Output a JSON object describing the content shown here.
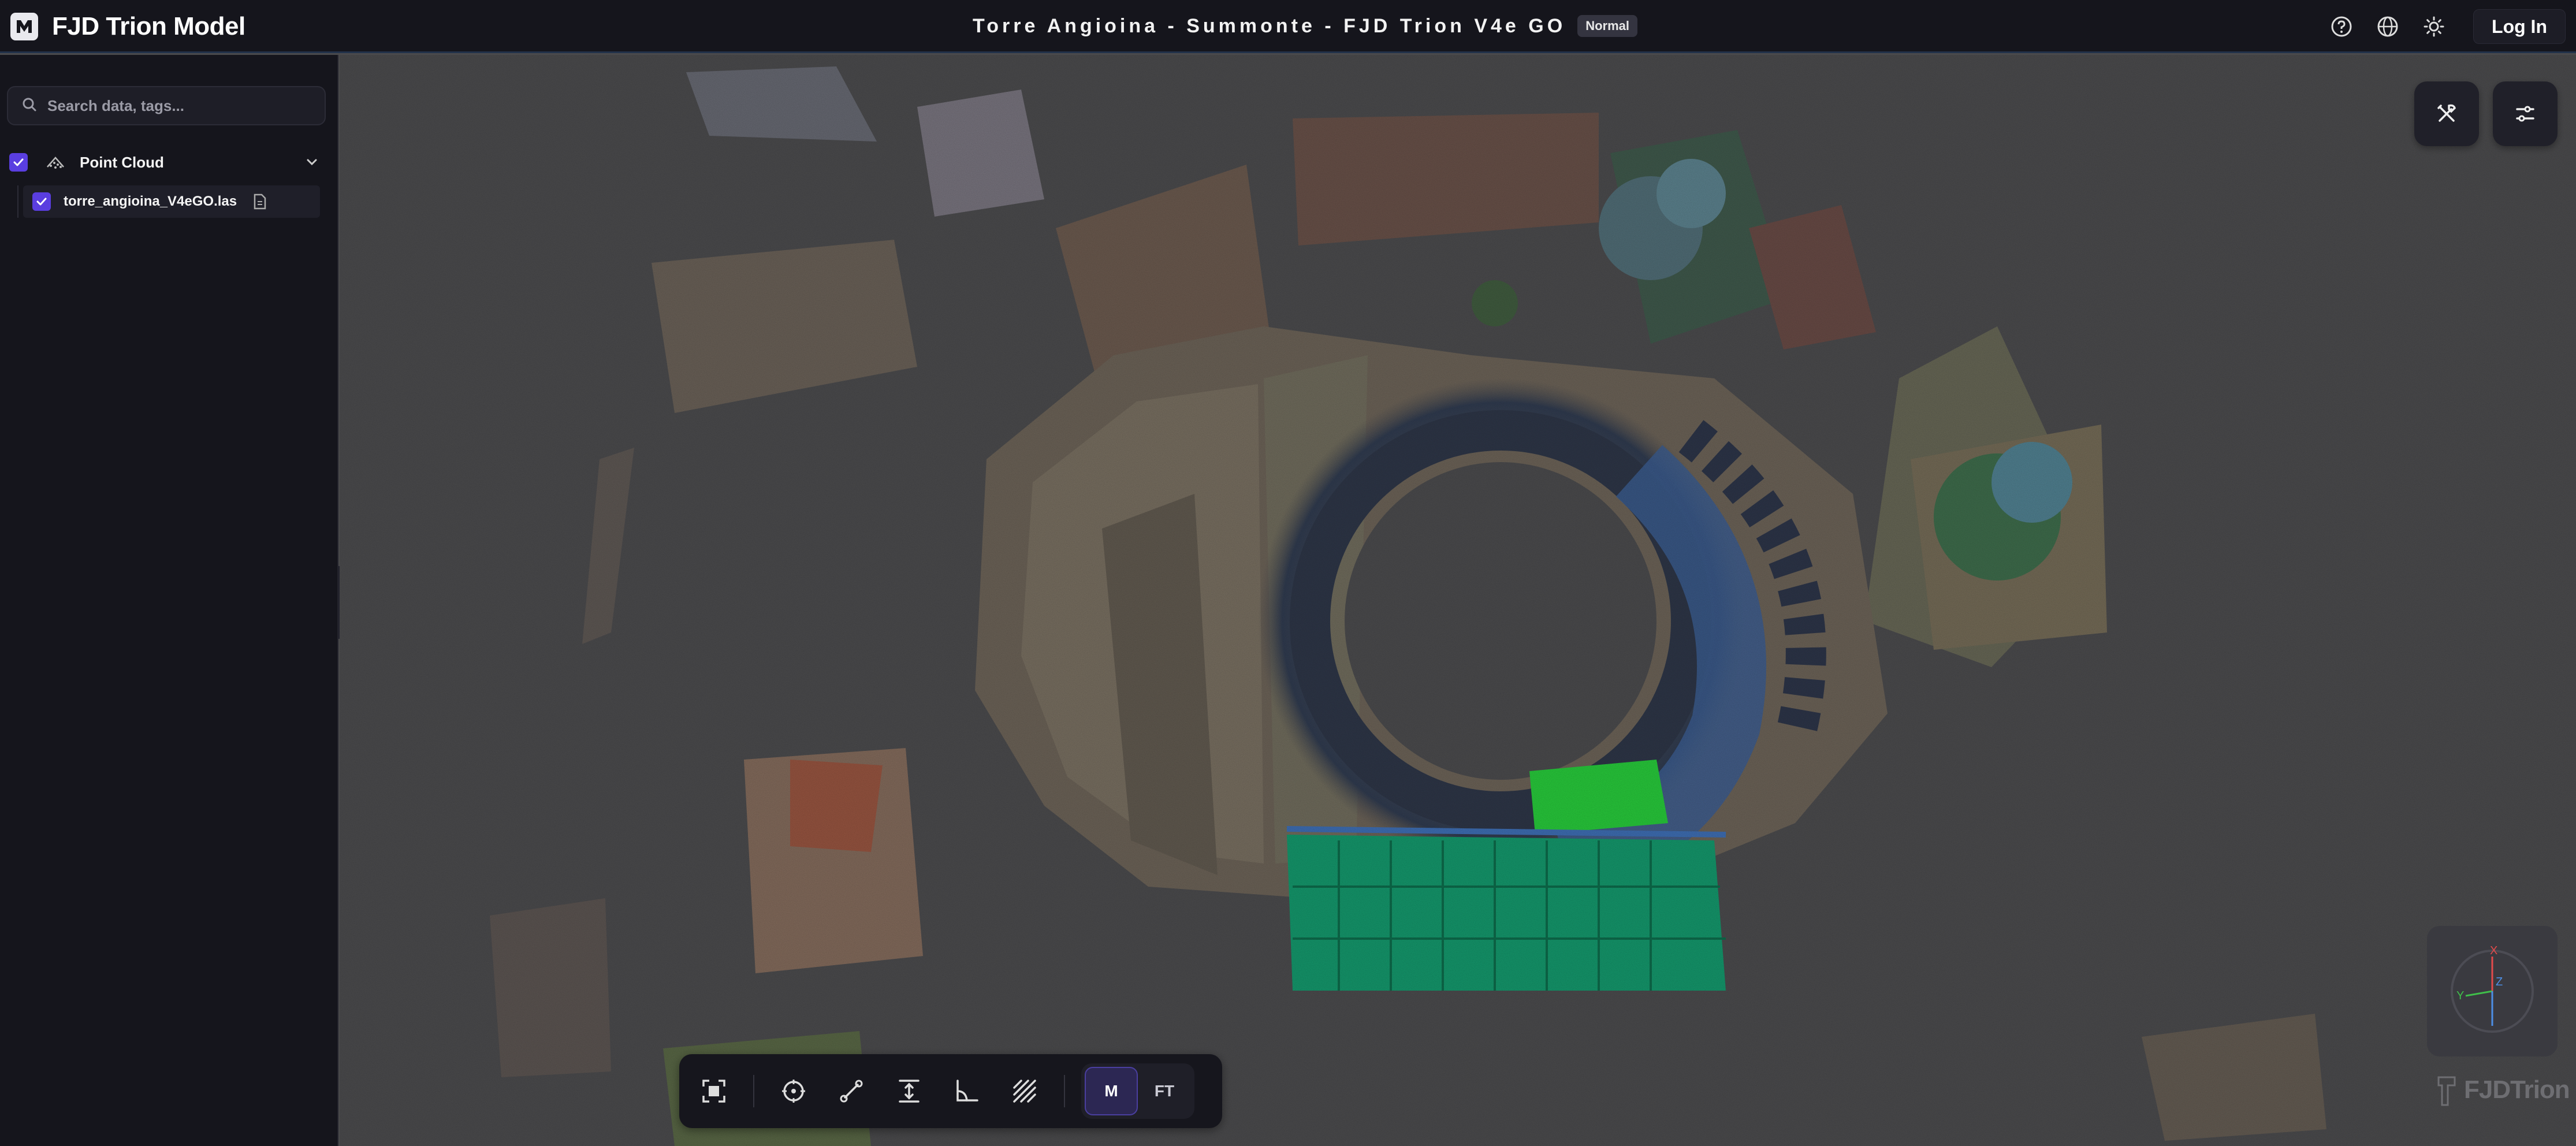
{
  "app": {
    "name": "FJD Trion Model",
    "document_title": "Torre Angioina - Summonte - FJD Trion V4e GO",
    "mode_badge": "Normal",
    "login_label": "Log In",
    "header_icons": [
      "help-icon",
      "globe-icon",
      "theme-sun-icon"
    ]
  },
  "sidebar": {
    "search": {
      "placeholder": "Search data, tags..."
    },
    "tree": [
      {
        "label": "Point Cloud",
        "checked": true,
        "expanded": true,
        "icon": "point-cloud-icon",
        "children": [
          {
            "label": "torre_angioina_V4eGO.las",
            "checked": true,
            "icon": "file-info-icon"
          }
        ]
      }
    ]
  },
  "viewport": {
    "top_right_buttons": [
      "tools-icon",
      "settings-sliders-icon"
    ],
    "compass_axes": [
      "X",
      "Y",
      "Z"
    ],
    "watermark": "FJDTrion"
  },
  "toolbar": {
    "tools": [
      "fit-view-icon",
      "point-pick-icon",
      "distance-measure-icon",
      "height-measure-icon",
      "angle-measure-icon",
      "area-hatch-icon"
    ],
    "modes": [
      {
        "label": "M",
        "active": true
      },
      {
        "label": "FT",
        "active": false
      }
    ]
  },
  "colors": {
    "background": "#4a4a4c",
    "panel": "#15151c",
    "accent": "#5a3ee0",
    "active_mode": "#2c2753"
  }
}
